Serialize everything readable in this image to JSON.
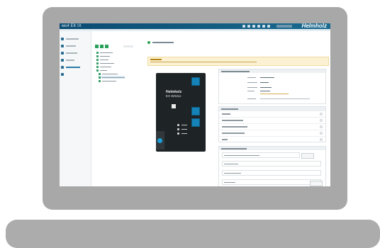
{
  "app": {
    "logo": "ᴍɢ4 EK IX",
    "brand": "Helmholz"
  },
  "device": {
    "brand": "Helmholz",
    "model": "EX WS2xx"
  },
  "colors": {
    "topbar": "#0b4b72",
    "accent": "#2ca34f",
    "device_port": "#1583b8",
    "warning_bg": "#fcf1d3"
  }
}
